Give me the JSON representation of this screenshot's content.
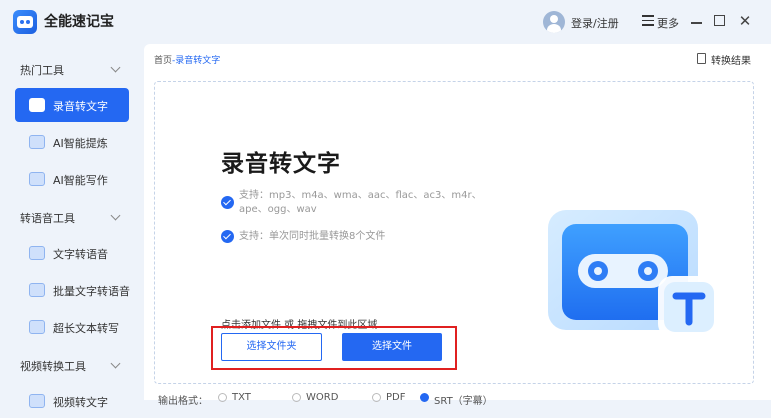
{
  "app": {
    "title": "全能速记宝"
  },
  "header": {
    "login": "登录/注册",
    "more": "更多",
    "close_glyph": "✕"
  },
  "sidebar": {
    "sections": [
      {
        "label": "热门工具"
      },
      {
        "label": "转语音工具"
      },
      {
        "label": "视频转换工具"
      }
    ],
    "items": [
      {
        "label": "录音转文字",
        "active": true
      },
      {
        "label": "AI智能提炼"
      },
      {
        "label": "AI智能写作"
      },
      {
        "label": "文字转语音"
      },
      {
        "label": "批量文字转语音"
      },
      {
        "label": "超长文本转写"
      },
      {
        "label": "视频转文字"
      }
    ]
  },
  "main": {
    "breadcrumb": {
      "home": "首页",
      "sep": "-",
      "current": "录音转文字"
    },
    "result_label": "转换结果",
    "title": "录音转文字",
    "features": [
      "支持：mp3、m4a、wma、aac、flac、ac3、m4r、ape、ogg、wav",
      "支持：单次同时批量转换8个文件"
    ],
    "hint": "点击添加文件 或 拖拽文件到此区域",
    "btn_folder": "选择文件夹",
    "btn_file": "选择文件",
    "output_format": {
      "label": "输出格式：",
      "options": [
        "TXT",
        "WORD",
        "PDF",
        "SRT（字幕）"
      ],
      "selected": "SRT（字幕）"
    }
  },
  "colors": {
    "accent": "#2468f2",
    "highlight_box": "#e02020"
  }
}
